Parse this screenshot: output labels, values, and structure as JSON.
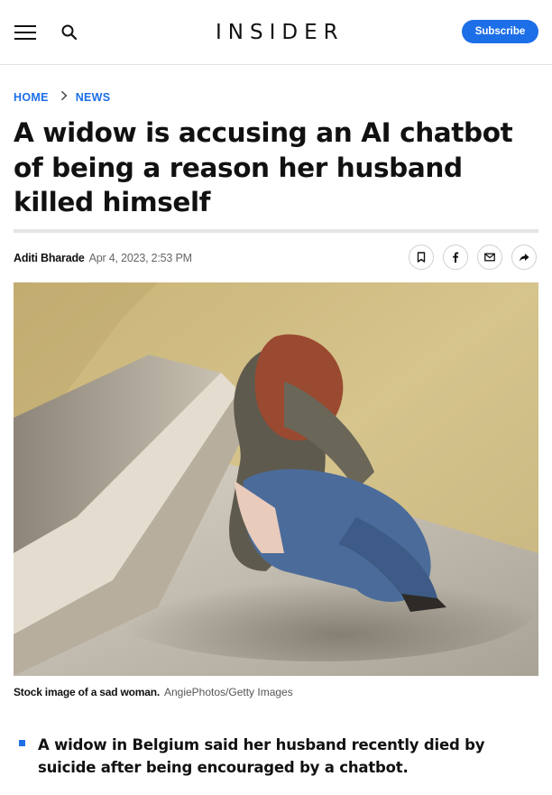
{
  "header": {
    "logo_text": "INSIDER",
    "subscribe_label": "Subscribe",
    "menu_icon": "hamburger-menu-icon",
    "search_icon": "search-icon",
    "accent_color": "#1d6fe8"
  },
  "breadcrumb": {
    "home_label": "HOME",
    "section_label": "NEWS"
  },
  "article": {
    "headline": "A widow is accusing an AI chatbot of being a reason her husband killed himself",
    "author": "Aditi Bharade",
    "date": "Apr 4, 2023, 2:53 PM",
    "share_icons": [
      "bookmark-icon",
      "facebook-icon",
      "email-icon",
      "share-icon"
    ],
    "image": {
      "caption": "Stock image of a sad woman.",
      "credit": "AngiePhotos/Getty Images"
    },
    "key_points": [
      "A widow in Belgium said her husband recently died by suicide after being encouraged by a chatbot."
    ]
  }
}
